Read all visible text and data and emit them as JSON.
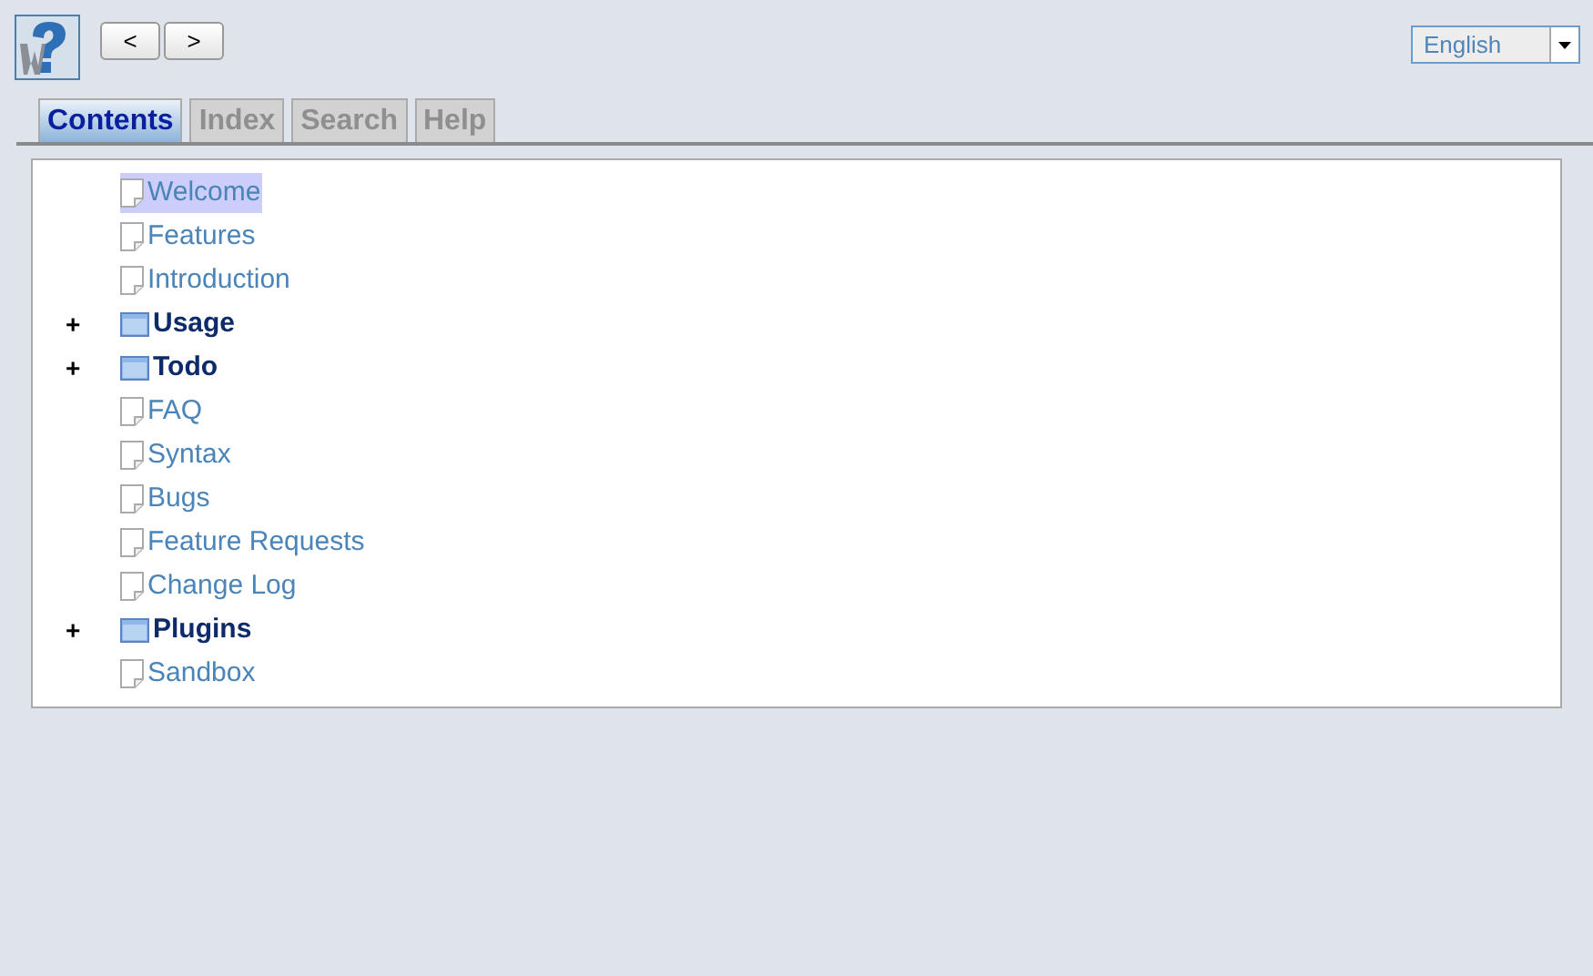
{
  "nav_buttons": [
    "<",
    ">"
  ],
  "language": {
    "value": "English"
  },
  "tabs": [
    {
      "label": "Contents",
      "selected": true
    },
    {
      "label": "Index",
      "selected": false
    },
    {
      "label": "Search",
      "selected": false
    },
    {
      "label": "Help",
      "selected": false
    }
  ],
  "tree": [
    {
      "kind": "page",
      "label": "Welcome",
      "selected": true
    },
    {
      "kind": "page",
      "label": "Features",
      "selected": false
    },
    {
      "kind": "page",
      "label": "Introduction",
      "selected": false
    },
    {
      "kind": "folder",
      "label": "Usage",
      "toggle": "+",
      "selected": false
    },
    {
      "kind": "folder",
      "label": "Todo",
      "toggle": "+",
      "selected": false
    },
    {
      "kind": "page",
      "label": "FAQ",
      "selected": false
    },
    {
      "kind": "page",
      "label": "Syntax",
      "selected": false
    },
    {
      "kind": "page",
      "label": "Bugs",
      "selected": false
    },
    {
      "kind": "page",
      "label": "Feature Requests",
      "selected": false
    },
    {
      "kind": "page",
      "label": "Change Log",
      "selected": false
    },
    {
      "kind": "folder",
      "label": "Plugins",
      "toggle": "+",
      "selected": false
    },
    {
      "kind": "page",
      "label": "Sandbox",
      "selected": false
    }
  ]
}
